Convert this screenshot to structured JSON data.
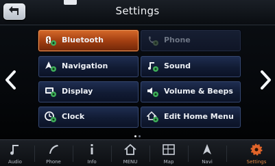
{
  "header": {
    "title": "Settings",
    "back_icon": "back-arrow-icon"
  },
  "nav": {
    "left_icon": "chevron-left-icon",
    "right_icon": "chevron-right-icon"
  },
  "menu": {
    "items": [
      {
        "label": "Bluetooth",
        "icon": "bluetooth-gear-icon",
        "state": "selected"
      },
      {
        "label": "Phone",
        "icon": "phone-gear-icon",
        "state": "disabled"
      },
      {
        "label": "Navigation",
        "icon": "navigation-gear-icon",
        "state": "normal"
      },
      {
        "label": "Sound",
        "icon": "music-note-gear-icon",
        "state": "normal"
      },
      {
        "label": "Display",
        "icon": "display-gear-icon",
        "state": "normal"
      },
      {
        "label": "Volume & Beeps",
        "icon": "speaker-gear-icon",
        "state": "normal"
      },
      {
        "label": "Clock",
        "icon": "clock-gear-icon",
        "state": "normal"
      },
      {
        "label": "Edit Home Menu",
        "icon": "home-gear-icon",
        "state": "normal"
      }
    ]
  },
  "pagination": {
    "current_page": 1,
    "total_pages": 2
  },
  "bottom_bar": {
    "items": [
      {
        "label": "Audio",
        "icon": "music-note-icon"
      },
      {
        "label": "Phone",
        "icon": "phone-handset-icon"
      },
      {
        "label": "Info",
        "icon": "info-icon"
      },
      {
        "label": "MENU",
        "icon": "home-icon"
      },
      {
        "label": "Map",
        "icon": "map-icon"
      },
      {
        "label": "Navi",
        "icon": "navigation-arrow-icon"
      },
      {
        "label": "Settings",
        "icon": "gear-icon",
        "selected": true
      }
    ]
  },
  "colors": {
    "accent_orange": "#d66a2a",
    "button_navy": "#1f2e52",
    "text_light": "#eef1f6",
    "text_disabled": "#6d7584"
  }
}
